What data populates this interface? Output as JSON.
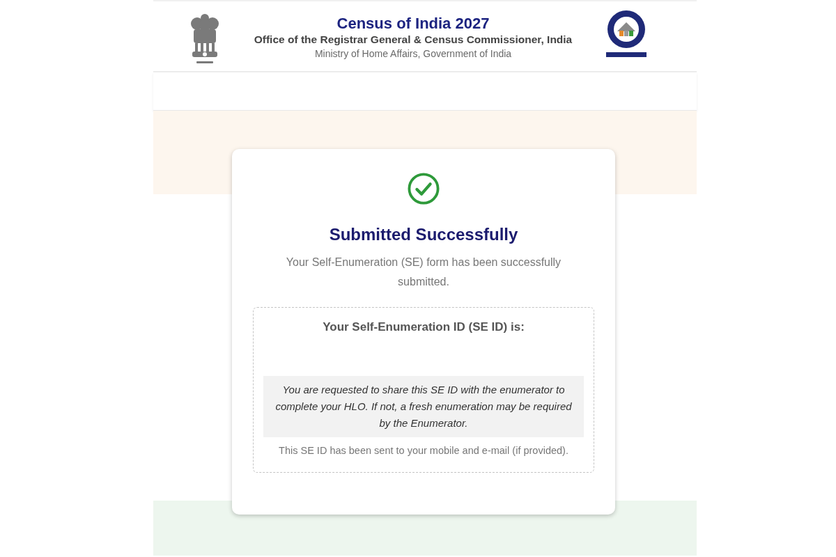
{
  "header": {
    "title": "Census of India 2027",
    "subtitle": "Office of the Registrar General & Census Commissioner, India",
    "ministry": "Ministry of Home Affairs, Government of India"
  },
  "card": {
    "submitted": true,
    "title": "Submitted Successfully",
    "message": "Your Self-Enumeration (SE) form has been successfully submitted.",
    "id_panel": {
      "heading": "Your Self-Enumeration ID (SE ID) is:",
      "notice": "You are requested to share this SE ID with the enumerator to complete your HLO. If not, a fresh enumeration may be required by the Enumerator.",
      "footnote": "This SE ID has been sent to your mobile and e-mail (if provided)."
    }
  }
}
